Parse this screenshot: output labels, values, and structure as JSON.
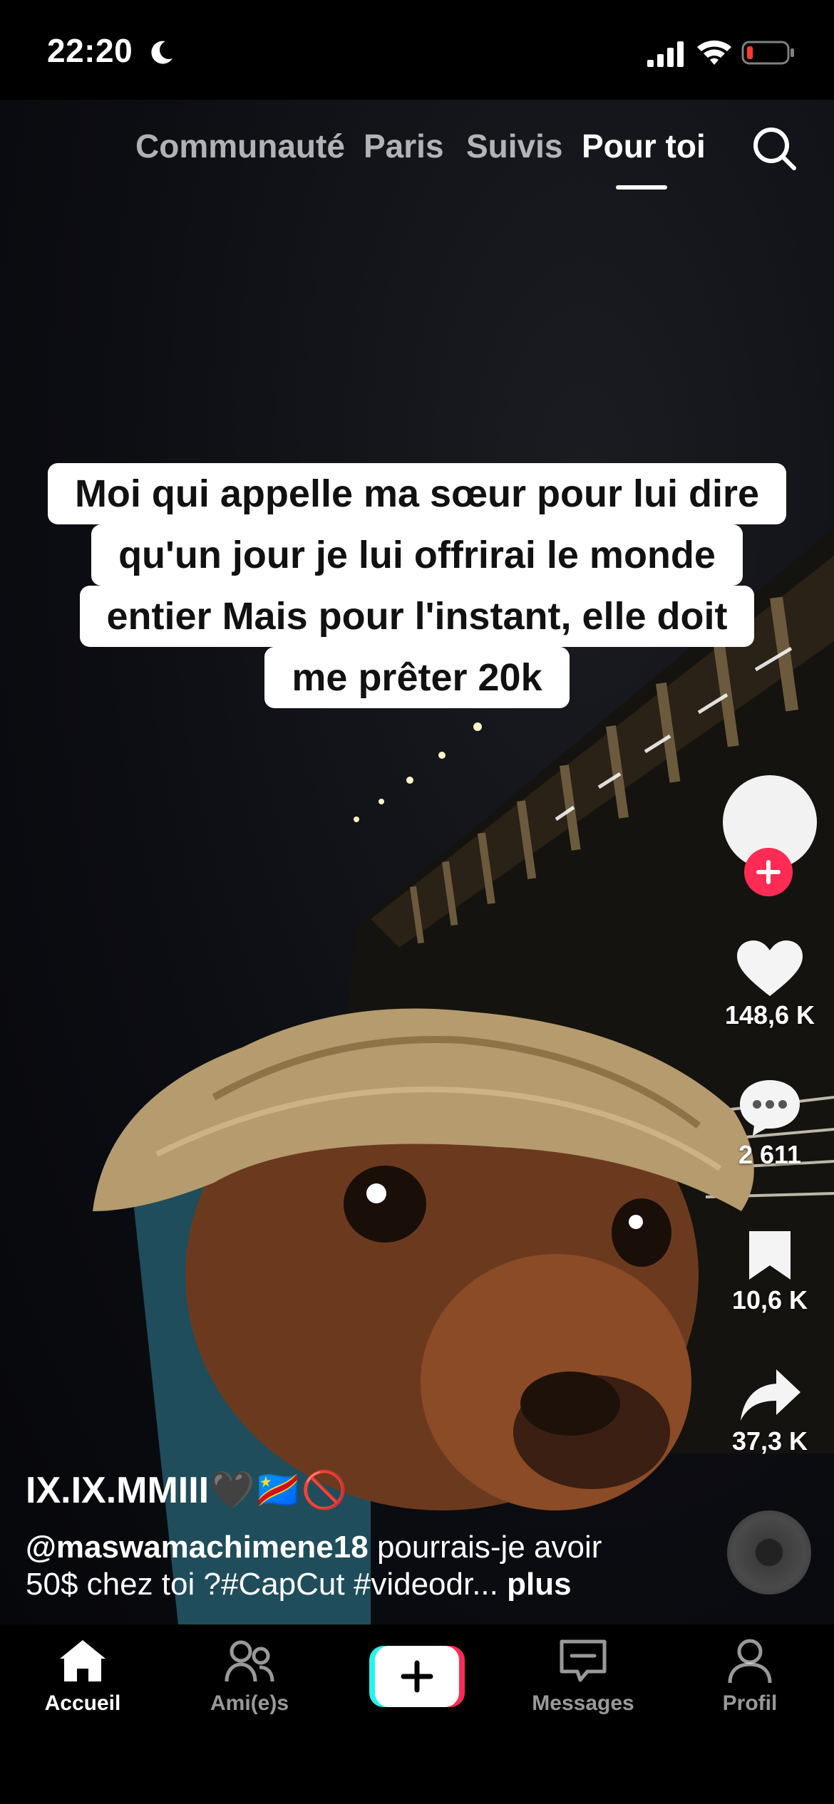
{
  "status_bar": {
    "time": "22:20"
  },
  "top_tabs": [
    {
      "label": "Communauté",
      "active": false
    },
    {
      "label": "Paris",
      "active": false
    },
    {
      "label": "Suivis",
      "active": false
    },
    {
      "label": "Pour toi",
      "active": true
    }
  ],
  "caption": {
    "lines": [
      "Moi qui appelle ma sœur pour lui dire",
      "qu'un jour je lui offrirai le monde",
      "entier Mais pour l'instant, elle doit",
      "me prêter 20k"
    ]
  },
  "actions": {
    "likes": "148,6 K",
    "comments": "2 611",
    "bookmarks": "10,6 K",
    "shares": "37,3 K"
  },
  "video_info": {
    "username": "IX.IX.MMIII🖤🇨🇩🚫",
    "mention": "@maswamachimene18",
    "text": " pourrais-je avoir 50$ chez toi ?#CapCut #videodr...",
    "more": " plus"
  },
  "bottom_nav": [
    {
      "label": "Accueil",
      "icon": "home-icon",
      "active": true
    },
    {
      "label": "Ami(e)s",
      "icon": "friends-icon",
      "active": false
    },
    {
      "label": "Messages",
      "icon": "messages-icon",
      "active": false
    },
    {
      "label": "Profil",
      "icon": "profile-icon",
      "active": false
    }
  ],
  "colors": {
    "accent_red": "#fe2c55",
    "accent_cyan": "#25f4ee",
    "background": "#000000",
    "battery_low": "#ff3b30"
  }
}
